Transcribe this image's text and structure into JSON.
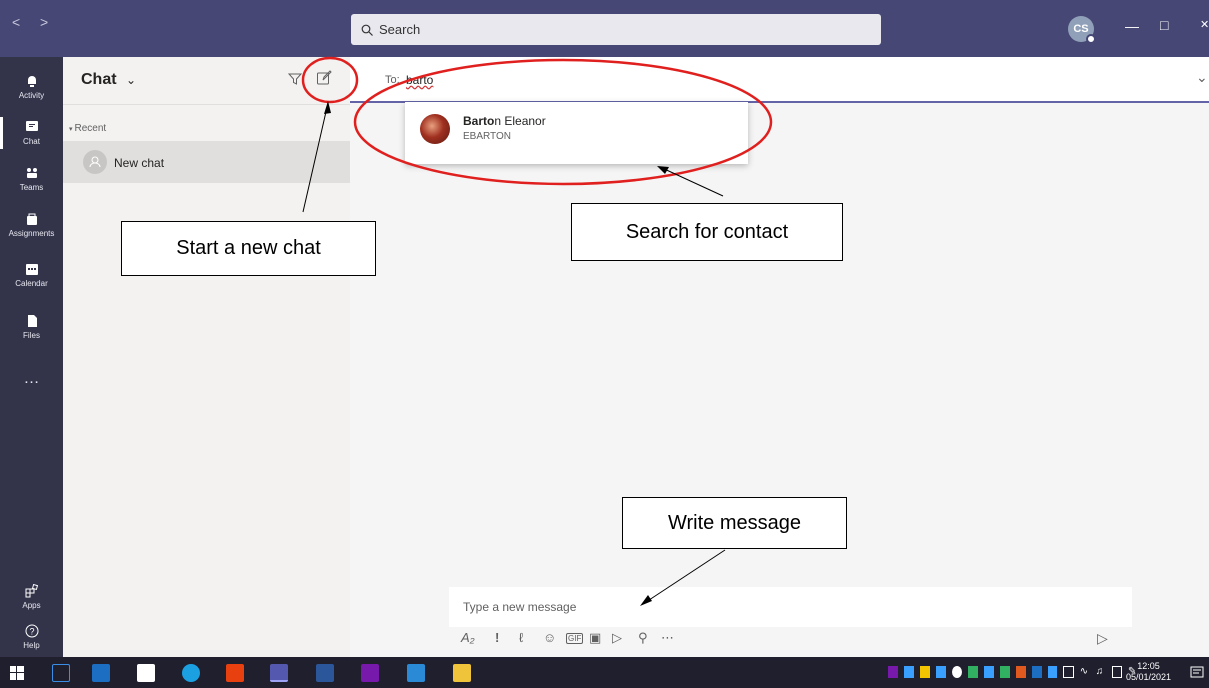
{
  "titlebar": {
    "back": "<",
    "forward": ">",
    "search_placeholder": "Search",
    "avatar_initials": "CS"
  },
  "rail": [
    {
      "label": "Activity",
      "icon": "bell-icon"
    },
    {
      "label": "Chat",
      "icon": "chat-icon"
    },
    {
      "label": "Teams",
      "icon": "teams-icon"
    },
    {
      "label": "Assignments",
      "icon": "assignments-icon"
    },
    {
      "label": "Calendar",
      "icon": "calendar-icon"
    },
    {
      "label": "Files",
      "icon": "files-icon"
    },
    {
      "label": "…",
      "icon": "more-icon"
    },
    {
      "label": "Apps",
      "icon": "apps-icon"
    },
    {
      "label": "Help",
      "icon": "help-icon"
    }
  ],
  "chat_panel": {
    "title": "Chat",
    "recent_label": "Recent",
    "items": [
      {
        "label": "New chat"
      }
    ]
  },
  "main": {
    "to_label": "To:",
    "to_value": "barto",
    "suggestion": {
      "name_bold": "Barto",
      "name_rest": "n Eleanor",
      "id": "EBARTON"
    },
    "compose_placeholder": "Type a new message"
  },
  "annotations": {
    "new_chat": "Start a new chat",
    "search_contact": "Search for contact",
    "write_message": "Write message"
  },
  "taskbar": {
    "time": "12:05",
    "date": "05/01/2021"
  }
}
